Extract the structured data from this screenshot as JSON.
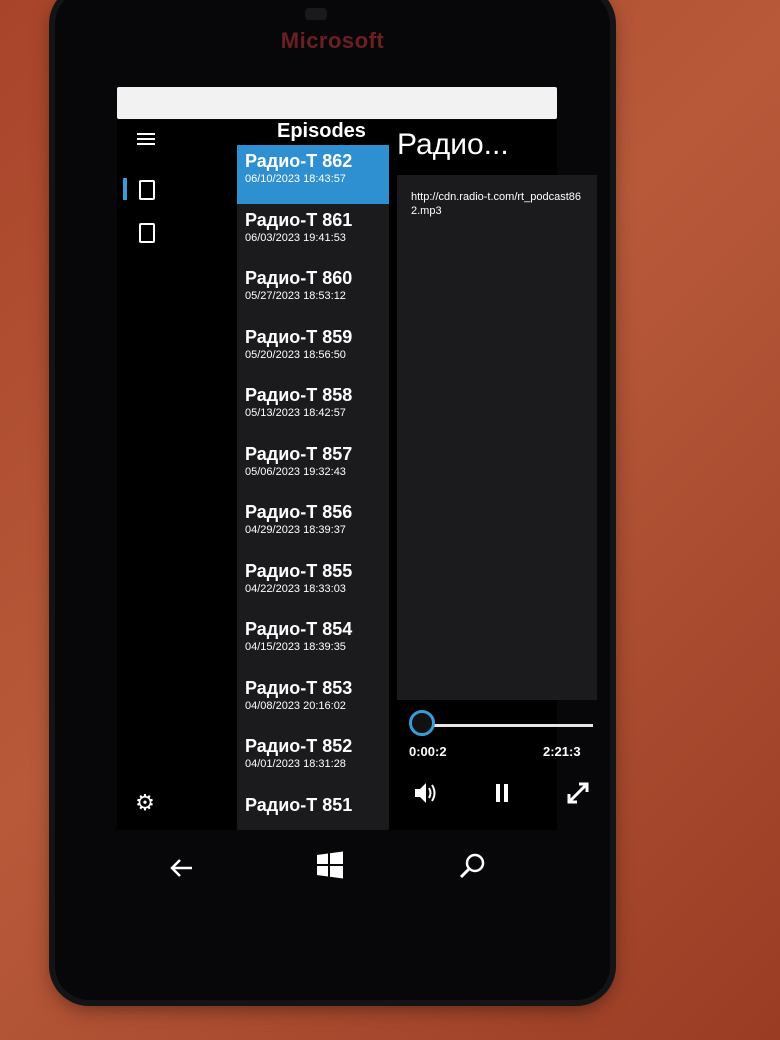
{
  "device": {
    "brand": "Microsoft"
  },
  "sidebar": {
    "menu_icon": "hamburger-icon",
    "items": [
      {
        "icon": "page-icon",
        "selected": true
      },
      {
        "icon": "page-icon",
        "selected": false
      }
    ],
    "settings_icon": "gear-icon"
  },
  "episodes": {
    "header": "Episodes",
    "items": [
      {
        "title": "Радио-Т 862",
        "date": "06/10/2023 18:43:57",
        "selected": true
      },
      {
        "title": "Радио-Т 861",
        "date": "06/03/2023 19:41:53"
      },
      {
        "title": "Радио-Т 860",
        "date": "05/27/2023 18:53:12"
      },
      {
        "title": "Радио-Т 859",
        "date": "05/20/2023 18:56:50"
      },
      {
        "title": "Радио-Т 858",
        "date": "05/13/2023 18:42:57"
      },
      {
        "title": "Радио-Т 857",
        "date": "05/06/2023 19:32:43"
      },
      {
        "title": "Радио-Т 856",
        "date": "04/29/2023 18:39:37"
      },
      {
        "title": "Радио-Т 855",
        "date": "04/22/2023 18:33:03"
      },
      {
        "title": "Радио-Т 854",
        "date": "04/15/2023 18:39:35"
      },
      {
        "title": "Радио-Т 853",
        "date": "04/08/2023 20:16:02"
      },
      {
        "title": "Радио-Т 852",
        "date": "04/01/2023 18:31:28"
      },
      {
        "title": "Радио-Т 851",
        "date": ""
      }
    ]
  },
  "player": {
    "title": "Радио...",
    "url": "http://cdn.radio-t.com/rt_podcast862.mp3",
    "position": "0:00:2",
    "duration": "2:21:3",
    "progress_fraction": 0.0,
    "volume_icon": "volume-icon",
    "pause_icon": "pause-icon",
    "fullscreen_icon": "fullscreen-icon",
    "accent_color": "#3a9bd9"
  },
  "navbar": {
    "back_icon": "back-arrow-icon",
    "start_icon": "windows-icon",
    "search_icon": "search-icon"
  }
}
